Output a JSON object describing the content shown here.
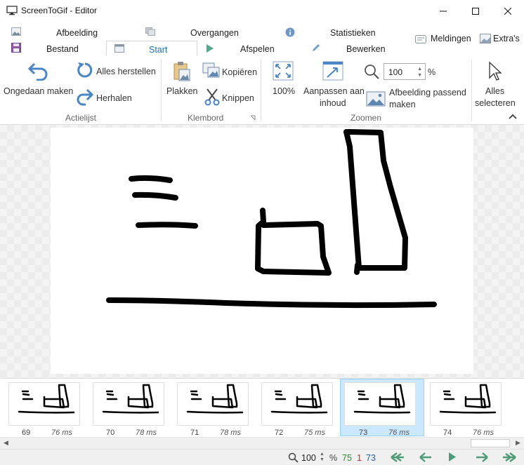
{
  "window": {
    "title": "ScreenToGif - Editor"
  },
  "tabs": {
    "top_row": [
      "Afbeelding",
      "Overgangen",
      "Statistieken"
    ],
    "bottom_row": [
      "Bestand",
      "Start",
      "Afspelen",
      "Bewerken"
    ],
    "right": [
      "Meldingen",
      "Extra's"
    ],
    "active": "Start"
  },
  "ribbon": {
    "undo": "Ongedaan maken",
    "reset_all": "Alles herstellen",
    "redo": "Herhalen",
    "group_actions": "Actielijst",
    "paste": "Plakken",
    "copy": "Kopiëren",
    "cut": "Knippen",
    "group_clipboard": "Klembord",
    "zoom_100": "100%",
    "fit_line1": "Aanpassen aan",
    "fit_line2": "inhoud",
    "zoom_value": "100",
    "percent": "%",
    "image_fit_line1": "Afbeelding passend",
    "image_fit_line2": "maken",
    "group_zoom": "Zoomen",
    "select_all_line1": "Alles",
    "select_all_line2": "selecteren"
  },
  "frames": [
    {
      "num": "69",
      "ms": "76 ms"
    },
    {
      "num": "70",
      "ms": "78 ms"
    },
    {
      "num": "71",
      "ms": "78 ms"
    },
    {
      "num": "72",
      "ms": "75 ms"
    },
    {
      "num": "73",
      "ms": "76 ms"
    },
    {
      "num": "74",
      "ms": "76 ms"
    }
  ],
  "selected_frame": "73",
  "status": {
    "zoom": "100",
    "percent": "%",
    "total": "75",
    "selected": "1",
    "current": "73"
  },
  "colors": {
    "accent": "#1e73be",
    "selection": "#cce8ff",
    "nav_green": "#4f9a79",
    "count_green": "#2e8b2e",
    "count_red": "#c62828",
    "count_blue": "#1e5fa8"
  }
}
